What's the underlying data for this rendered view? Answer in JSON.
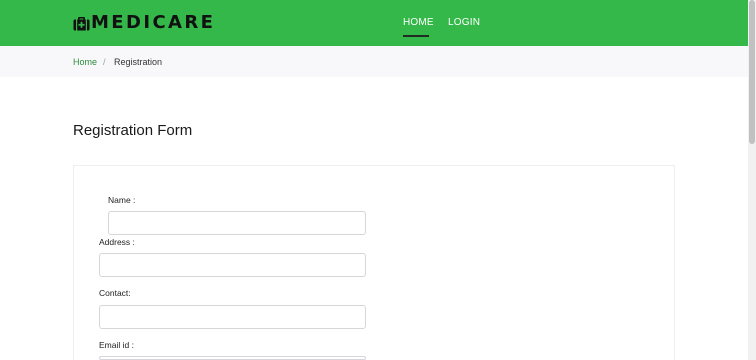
{
  "brand": {
    "name": "MEDICARE",
    "icon": "medical-kit-icon",
    "color": "#34b84a"
  },
  "nav": {
    "items": [
      {
        "label": "HOME",
        "active": true
      },
      {
        "label": "LOGIN",
        "active": false
      }
    ]
  },
  "breadcrumb": {
    "home": "Home",
    "separator": "/",
    "current": "Registration"
  },
  "page": {
    "title": "Registration Form"
  },
  "form": {
    "fields": [
      {
        "label": "Name :",
        "value": "",
        "placeholder": ""
      },
      {
        "label": "Address :",
        "value": "",
        "placeholder": ""
      },
      {
        "label": "Contact:",
        "value": "",
        "placeholder": ""
      },
      {
        "label": "Email id :",
        "value": "",
        "placeholder": ""
      }
    ]
  }
}
